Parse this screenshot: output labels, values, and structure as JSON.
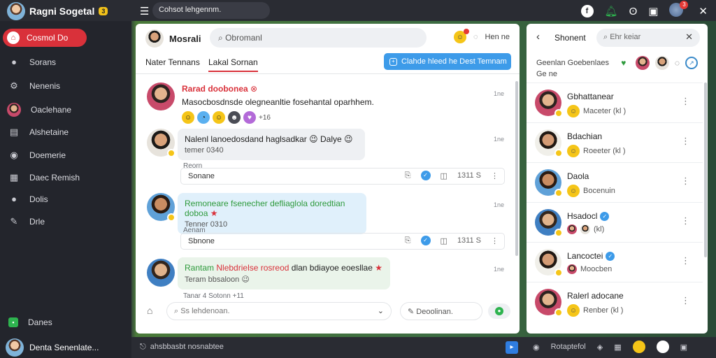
{
  "topbar": {
    "app_title": "Ragni Sogetal",
    "app_badge": "3",
    "search_text": "Cohsot lehgennm.",
    "notif_count": "3"
  },
  "sidebar": {
    "active_label": "Cosmol Do",
    "items": [
      {
        "label": "Sorans",
        "icon": "search-icon"
      },
      {
        "label": "Nenenis",
        "icon": "settings-icon"
      },
      {
        "label": "Oaclehane",
        "icon": "avatar-icon"
      },
      {
        "label": "Alshetaine",
        "icon": "folder-icon"
      },
      {
        "label": "Doemerie",
        "icon": "chat-icon"
      },
      {
        "label": "Daec Remish",
        "icon": "calendar-icon"
      },
      {
        "label": "Dolis",
        "icon": "comment-icon"
      },
      {
        "label": "Drle",
        "icon": "pin-icon"
      }
    ],
    "bottom_item": "Danes",
    "user_name": "Denta Senenlate..."
  },
  "chat": {
    "title": "Mosrali",
    "search_placeholder": "Obromanl",
    "header_right": "Hen ne",
    "tabs": [
      "Nater Tennans",
      "Lakal Sornan"
    ],
    "action_button": "Clahde hleed he Dest Temnam",
    "messages": [
      {
        "name": "Rarad doobonea",
        "text": "Masocbosdnsde olegneanltie fosehantal oparhhem.",
        "extra": "+16",
        "time": "1ne"
      },
      {
        "text": "Nalenl lanoedosdand haglsadkar 😉 Dalye 😉",
        "sub": "temer 0340",
        "time": "1ne",
        "reply_label": "Reorn",
        "reply_text": "Sonane",
        "reply_meta": "1311 S"
      },
      {
        "text": "Remoneare fsenecher defliaglola doredtian doboa",
        "sub": "Tenner 0310",
        "time": "1ne",
        "reply_label": "Aenam",
        "reply_text": "Sbnone",
        "reply_meta": "1311 S"
      },
      {
        "name_green": "Rantam",
        "name_red": "Nlebdrielse rosreod",
        "text_tail": "dlan bdiayoe eoesllae",
        "sub": "Teram bbsaloon 😉",
        "time": "1ne",
        "footer": "Tanar 4 Sotonn  +11"
      }
    ],
    "footer_placeholder": "Ss lehdenoan.",
    "footer_placeholder2": "Deoolinan."
  },
  "contacts": {
    "title": "Shonent",
    "search_placeholder": "Ehr keiar",
    "sub_line1": "Geenlan Goebenlaes",
    "sub_line2": "Ge ne",
    "list": [
      {
        "name": "Gbhattanear",
        "status": "Maceter (kl )",
        "verified": false
      },
      {
        "name": "Bdachian",
        "status": "Roeeter (kl )",
        "verified": false
      },
      {
        "name": "Daola",
        "status": "Bocenuin",
        "verified": false
      },
      {
        "name": "Hsadocl",
        "status": "(kl)",
        "verified": true
      },
      {
        "name": "Lancoctei",
        "status": "Moocben",
        "verified": true
      },
      {
        "name": "Ralerl adocane",
        "status": "Renber (kl )",
        "verified": false
      }
    ]
  },
  "bottombar": {
    "left_text": "ahsbbasbt nosnabtee",
    "right_text": "Rotaptefol"
  },
  "colors": {
    "accent_red": "#d9313a",
    "accent_blue": "#3d9be9",
    "accent_green": "#2eb34f"
  }
}
